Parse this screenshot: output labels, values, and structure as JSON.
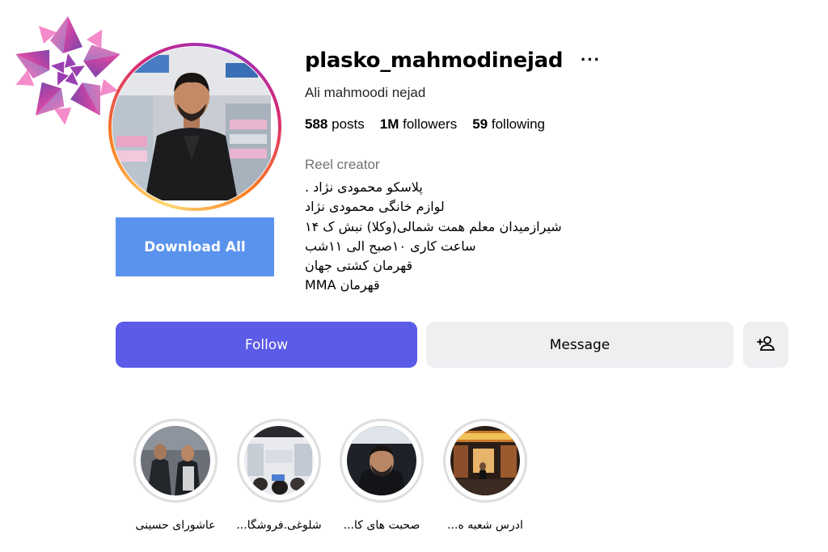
{
  "profile": {
    "username": "plasko_mahmodinejad",
    "full_name": "Ali mahmoodi nejad",
    "more_icon": "ellipsis-icon",
    "stats": {
      "posts_count": "588",
      "posts_label": "posts",
      "followers_count": "1M",
      "followers_label": "followers",
      "following_count": "59",
      "following_label": "following"
    },
    "category": "Reel creator",
    "bio_lines": [
      "پلاسکو محمودی نژاد .",
      "لوازم خانگی محمودی نژاد",
      "شیرازمیدان معلم همت شمالی(وکلا) نبش ک ۱۴",
      "ساعت کاری ۱۰صبح الی ۱۱شب",
      "قهرمان کشتی جهان",
      "قهرمان MMA"
    ]
  },
  "actions": {
    "download_all": "Download All",
    "follow": "Follow",
    "message": "Message",
    "add_user_icon": "person-add-icon"
  },
  "highlights": [
    {
      "label": "عاشورای حسینی"
    },
    {
      "label": "شلوغی.فروشگا..."
    },
    {
      "label": "صحبت های کا..."
    },
    {
      "label": "ادرس شعبه ه..."
    }
  ],
  "colors": {
    "follow_button": "#5b5be8",
    "download_button": "#5a93ee",
    "secondary_button": "#efeff2",
    "muted_text": "#737373"
  }
}
